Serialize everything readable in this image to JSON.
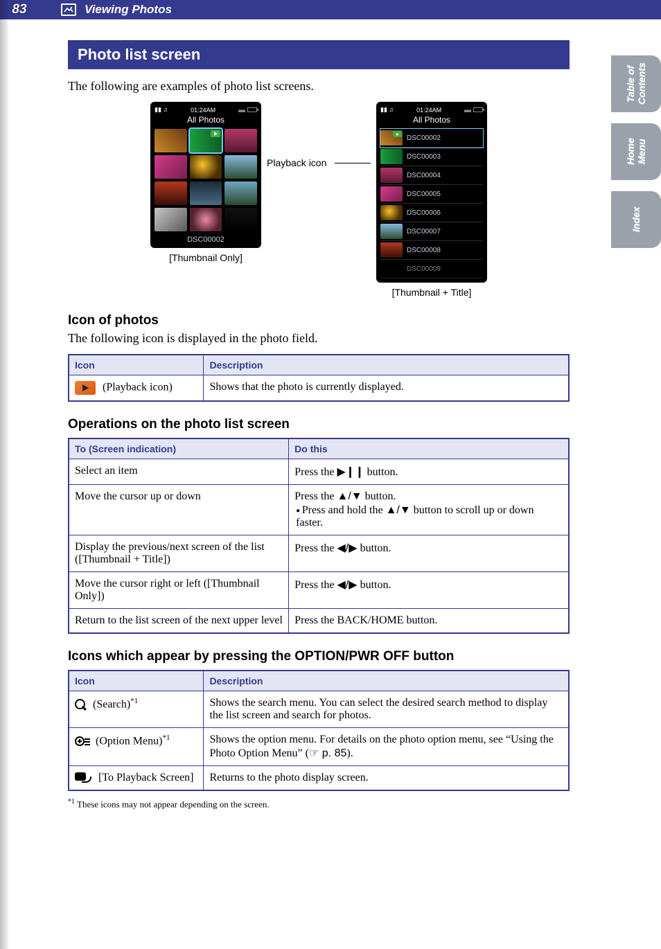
{
  "header": {
    "page_number": "83",
    "section": "Viewing Photos"
  },
  "side_tabs": {
    "tab1_line1": "Table of",
    "tab1_line2": "Contents",
    "tab2_line1": "Home",
    "tab2_line2": "Menu",
    "tab3": "Index"
  },
  "banner": "Photo list screen",
  "intro": "The following are examples of photo list screens.",
  "device": {
    "time": "01:24AM",
    "screen_title": "All Photos",
    "thumbnail_footer": "DSC00002",
    "list_items": [
      "DSC00002",
      "DSC00003",
      "DSC00004",
      "DSC00005",
      "DSC00006",
      "DSC00007",
      "DSC00008",
      "DSC00009"
    ]
  },
  "captions": {
    "left": "[Thumbnail Only]",
    "right": "[Thumbnail + Title]",
    "playback_icon": "Playback icon"
  },
  "sec_icon": {
    "heading": "Icon of photos",
    "intro": "The following icon is displayed in the photo field.",
    "table": {
      "h1": "Icon",
      "h2": "Description",
      "row1_icon_label": " (Playback icon)",
      "row1_desc": "Shows that the photo is currently displayed."
    }
  },
  "sec_ops": {
    "heading": "Operations on the photo list screen",
    "table": {
      "h1": "To (Screen indication)",
      "h2": "Do this",
      "rows": [
        {
          "to": "Select an item",
          "do_pre": "Press the ",
          "do_sym": "▶❙❙",
          "do_post": " button."
        },
        {
          "to": "Move the cursor up or down",
          "do_line1_pre": "Press the ",
          "do_line1_sym": "▲/▼",
          "do_line1_post": " button.",
          "do_bullet_pre": "Press and hold the ",
          "do_bullet_sym": "▲/▼",
          "do_bullet_post": " button to scroll up or down faster."
        },
        {
          "to": "Display the previous/next screen of the list ([Thumbnail + Title])",
          "do_pre": "Press the ",
          "do_sym": "◀/▶",
          "do_post": " button."
        },
        {
          "to": "Move the cursor right or left ([Thumbnail Only])",
          "do_pre": "Press the ",
          "do_sym": "◀/▶",
          "do_post": " button."
        },
        {
          "to": "Return to the list screen of the next upper level",
          "do": "Press the BACK/HOME button."
        }
      ]
    }
  },
  "sec_opt": {
    "heading": "Icons which appear by pressing the OPTION/PWR OFF button",
    "table": {
      "h1": "Icon",
      "h2": "Description",
      "rows": [
        {
          "icon_label_pre": " (Search)",
          "sup": "*1",
          "desc": "Shows the search menu. You can select the desired search method to display the list screen and search for photos."
        },
        {
          "icon_label_pre": " (Option Menu)",
          "sup": "*1",
          "desc_pre": "Shows the option menu. For details on the photo option menu, see “Using the Photo Option Menu” (",
          "desc_ref": "☞ p. 85",
          "desc_post": ")."
        },
        {
          "icon_label": " [To Playback Screen]",
          "desc": "Returns to the photo display screen."
        }
      ]
    },
    "footnote_sup": "*1",
    "footnote": "  These icons may not appear depending on the screen."
  }
}
